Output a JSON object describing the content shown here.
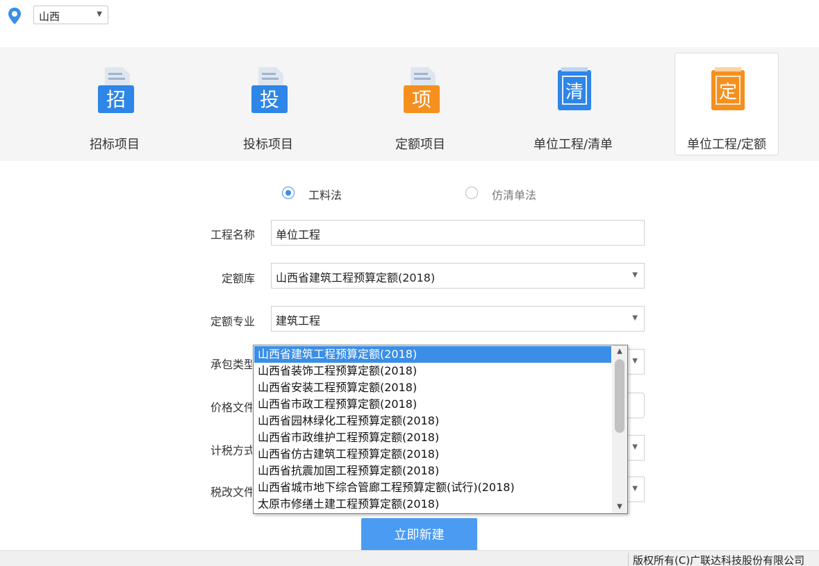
{
  "region": {
    "selected": "山西"
  },
  "project_types": [
    {
      "label": "招标项目",
      "icon_char": "招",
      "icon_color": "#2d86e8"
    },
    {
      "label": "投标项目",
      "icon_char": "投",
      "icon_color": "#2d86e8"
    },
    {
      "label": "定额项目",
      "icon_char": "项",
      "icon_color": "#f5901e"
    },
    {
      "label": "单位工程/清单",
      "icon_char": "清",
      "icon_color": "#2d86e8"
    },
    {
      "label": "单位工程/定额",
      "icon_char": "定",
      "icon_color": "#f5901e"
    }
  ],
  "method": {
    "option_1": "工料法",
    "option_2": "仿清单法"
  },
  "form": {
    "name_label": "工程名称",
    "name_value": "单位工程",
    "quota_lib_label": "定额库",
    "quota_lib_value": "山西省建筑工程预算定额(2018)",
    "quota_major_label": "定额专业",
    "quota_major_value": "建筑工程",
    "contract_type_label": "承包类型",
    "price_file_label": "价格文件",
    "tax_method_label": "计税方式",
    "tax_reform_label": "税改文件"
  },
  "dropdown_items": [
    "山西省建筑工程预算定额(2018)",
    "山西省装饰工程预算定额(2018)",
    "山西省安装工程预算定额(2018)",
    "山西省市政工程预算定额(2018)",
    "山西省园林绿化工程预算定额(2018)",
    "山西省市政维护工程预算定额(2018)",
    "山西省仿古建筑工程预算定额(2018)",
    "山西省抗震加固工程预算定额(2018)",
    "山西省城市地下综合管廊工程预算定额(试行)(2018)",
    "太原市修缮土建工程预算定额(2018)"
  ],
  "create_button": "立即新建",
  "footer": {
    "copyright": "版权所有(C)广联达科技股份有限公司"
  },
  "colors": {
    "accent": "#3a8ee6",
    "orange": "#f5901e"
  }
}
